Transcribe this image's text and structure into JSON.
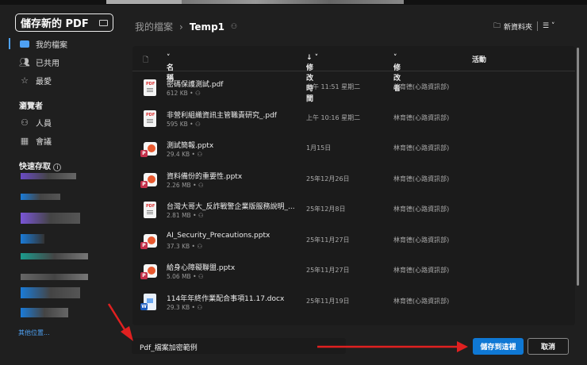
{
  "dialog_title": "儲存新的 PDF",
  "sidebar": {
    "items": [
      {
        "label": "我的檔案",
        "icon": "folder-icon"
      },
      {
        "label": "已共用",
        "icon": "people-icon"
      },
      {
        "label": "最愛",
        "icon": "star-icon"
      }
    ],
    "browse_heading": "瀏覽者",
    "browse_items": [
      {
        "label": "人員",
        "icon": "person-icon"
      },
      {
        "label": "會議",
        "icon": "calendar-icon"
      }
    ],
    "quick_access_heading": "快速存取",
    "other_locations": "其他位置..."
  },
  "breadcrumb": {
    "root": "我的檔案",
    "current": "Temp1"
  },
  "toolbar": {
    "new_folder": "新資料夾"
  },
  "columns": {
    "name": "名稱",
    "modified": "修改時間",
    "modified_by": "修改者",
    "activity": "活動"
  },
  "files": [
    {
      "name": "密碼保護測試.pdf",
      "size": "612 KB",
      "modified": "上午 11:51 星期二",
      "by": "林育德(心路資訊部)",
      "type": "pdf"
    },
    {
      "name": "非營利組織資訊主管職責研究_.pdf",
      "size": "595 KB",
      "modified": "上午 10:16 星期二",
      "by": "林育德(心路資訊部)",
      "type": "pdf"
    },
    {
      "name": "測試簡報.pptx",
      "size": "29.4 KB",
      "modified": "1月15日",
      "by": "林育德(心路資訊部)",
      "type": "pptx"
    },
    {
      "name": "資料備份的重要性.pptx",
      "size": "2.26 MB",
      "modified": "25年12月26日",
      "by": "林育德(心路資訊部)",
      "type": "pptx"
    },
    {
      "name": "台灣大哥大_反詐戰警企業版服務說明_...",
      "size": "2.81 MB",
      "modified": "25年12月8日",
      "by": "林育德(心路資訊部)",
      "type": "pdf"
    },
    {
      "name": "AI_Security_Precautions.pptx",
      "size": "37.3 KB",
      "modified": "25年11月27日",
      "by": "林育德(心路資訊部)",
      "type": "pptx"
    },
    {
      "name": "給身心障礙聯盟.pptx",
      "size": "5.06 MB",
      "modified": "25年11月27日",
      "by": "林育德(心路資訊部)",
      "type": "pptx"
    },
    {
      "name": "114年年終作業配合事項11.17.docx",
      "size": "29.3 KB",
      "modified": "25年11月19日",
      "by": "林育德(心路資訊部)",
      "type": "docx"
    }
  ],
  "filename": "Pdf_檔案加密範例",
  "buttons": {
    "save": "儲存到這裡",
    "cancel": "取消"
  },
  "colors": {
    "accent": "#0f78d4",
    "arrow": "#e02020"
  }
}
